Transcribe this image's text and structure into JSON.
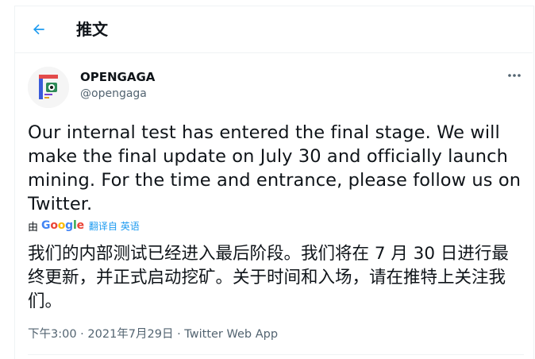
{
  "header": {
    "title": "推文",
    "back_icon": "arrow-left-icon",
    "accent_color": "#1d9bf0"
  },
  "author": {
    "display_name": "OPENGAGA",
    "handle": "@opengaga",
    "avatar_icon": "opengaga-logo"
  },
  "more_icon": "more-horizontal-icon",
  "tweet": {
    "text": "Our internal test has entered the final stage. We will make the final update on July 30 and officially launch mining. For the time and entrance, please follow us on Twitter."
  },
  "translation": {
    "by_label": "由",
    "provider": "Google",
    "translate_label": "翻译自 英语",
    "text": "我们的内部测试已经进入最后阶段。我们将在 7 月 30 日进行最终更新，并正式启动挖矿。关于时间和入场，请在推特上关注我们。"
  },
  "meta": {
    "time": "下午3:00",
    "date": "2021年7月29日",
    "source": "Twitter Web App",
    "separator": " · "
  }
}
